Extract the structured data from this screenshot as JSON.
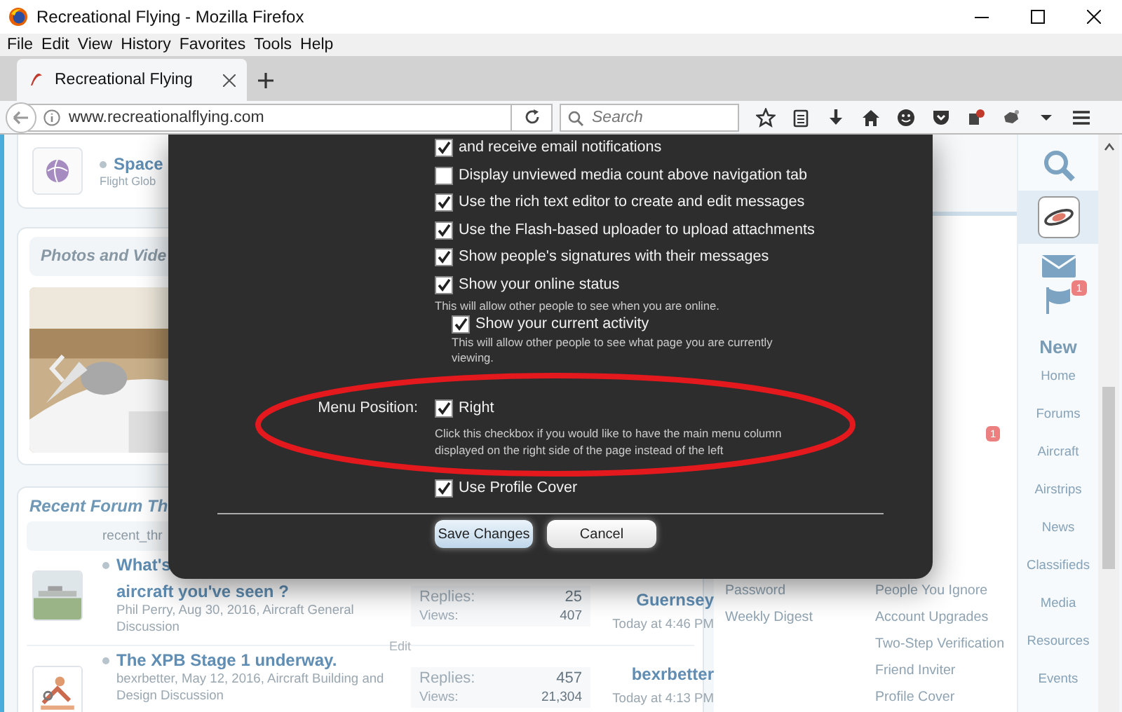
{
  "window": {
    "title": "Recreational Flying - Mozilla Firefox"
  },
  "menu": [
    "File",
    "Edit",
    "View",
    "History",
    "Favorites",
    "Tools",
    "Help"
  ],
  "tabs": [
    {
      "label": "Recreational Flying",
      "selected": true
    }
  ],
  "address_bar": {
    "value": "www.recreationalflying.com"
  },
  "search": {
    "placeholder": "Search"
  },
  "news": {
    "title": "Space",
    "meta": "Flight Glob"
  },
  "media": {
    "title": "Photos and Vide"
  },
  "threads": {
    "title": "Recent Forum Th",
    "columns": [
      "recent_thr"
    ],
    "rows": [
      {
        "title_lines": [
          "What's",
          "aircraft you've seen ?"
        ],
        "meta": "Phil Perry, Aug 30, 2016, Aircraft General Discussion",
        "edit": "Edit",
        "replies_label": "Replies:",
        "replies": "25",
        "views_label": "Views:",
        "views": "407",
        "last_user": "Guernsey",
        "last_time": "Today at 4:46 PM"
      },
      {
        "title_lines": [
          "The XPB Stage 1 underway."
        ],
        "meta": "bexrbetter, May 12, 2016, Aircraft Building and Design Discussion",
        "replies_label": "Replies:",
        "replies": "457",
        "views_label": "Views:",
        "views": "21,304",
        "last_user": "bexrbetter",
        "last_time": "Today at 4:13 PM"
      }
    ]
  },
  "profile": {
    "alerts_badge": "1",
    "menu_left": [
      "Password",
      "Weekly Digest"
    ],
    "menu_right": [
      "People You Ignore",
      "Account Upgrades",
      "Two-Step Verification",
      "Friend Inviter",
      "Profile Cover"
    ]
  },
  "side_nav": {
    "icons": [
      {
        "kind": "search"
      },
      {
        "kind": "avatar",
        "selected": true
      },
      {
        "kind": "mail"
      },
      {
        "kind": "alerts",
        "badge": "1"
      }
    ],
    "heading": "New",
    "links": [
      "Home",
      "Forums",
      "Aircraft",
      "Airstrips",
      "News",
      "Classifieds",
      "Media",
      "Resources",
      "Events"
    ]
  },
  "modal": {
    "options": [
      {
        "label": "and receive email notifications",
        "checked": true
      },
      {
        "label": "Display unviewed media count above navigation tab",
        "checked": false
      },
      {
        "label": "Use the rich text editor to create and edit messages",
        "checked": true
      },
      {
        "label": "Use the Flash-based uploader to upload attachments",
        "checked": true
      },
      {
        "label": "Show people's signatures with their messages",
        "checked": true
      },
      {
        "label": "Show your online status",
        "checked": true,
        "hint": "This will allow other people to see when you are online.",
        "children": [
          {
            "label": "Show your current activity",
            "checked": true,
            "hint": "This will allow other people to see what page you are currently viewing."
          }
        ]
      },
      {
        "field_label": "Menu Position:",
        "label": "Right",
        "checked": true,
        "hint": "Click this checkbox if you would like to have the main menu column displayed on the right side of the page instead of the left"
      },
      {
        "label": "Use Profile Cover",
        "checked": true
      }
    ],
    "buttons": [
      {
        "label": "Save Changes",
        "kind": "primary"
      },
      {
        "label": "Cancel",
        "kind": "secondary"
      }
    ]
  }
}
